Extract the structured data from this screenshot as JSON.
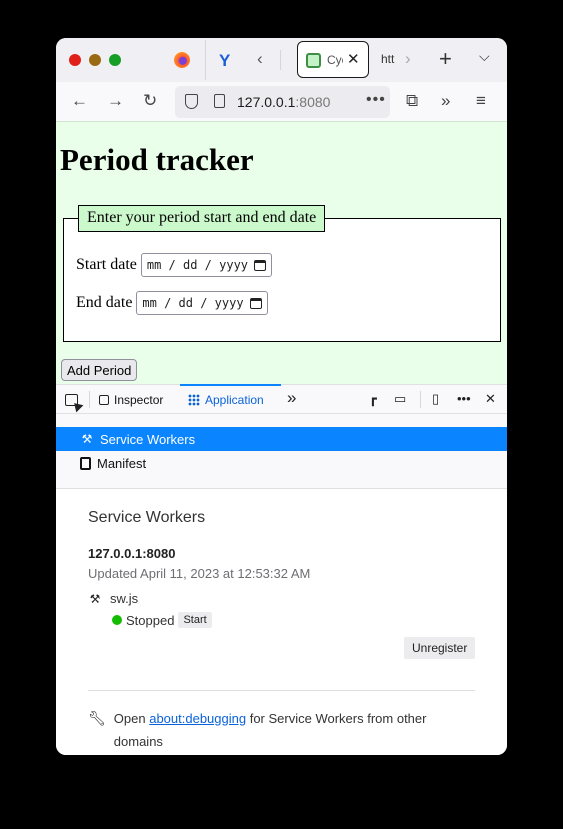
{
  "browser": {
    "tabs": [
      {
        "title": "Cycle Tracker",
        "visible_text": "Cyc",
        "active": true
      },
      {
        "title": "htt",
        "visible_text": "htt",
        "active": false
      }
    ],
    "url_host": "127.0.0.1",
    "url_port": ":8080",
    "icons": {
      "back": "←",
      "forward": "→",
      "reload": "↻",
      "more": "•••",
      "extensions": "⧉",
      "overflow": "»",
      "menu": "≡",
      "tab_scroll_left": "‹",
      "tab_scroll_right": "›",
      "new_tab": "+",
      "tab_list": "⌄",
      "close_tab": "✕"
    }
  },
  "page": {
    "title": "Period tracker",
    "legend": "Enter your period start and end date",
    "start_label": "Start date",
    "end_label": "End date",
    "date_placeholder": "mm / dd / yyyy",
    "add_button": "Add Period",
    "background_color": "#e9ffe9",
    "legend_color": "#ccf9cc"
  },
  "devtools": {
    "toolbar": {
      "tabs": [
        {
          "label": "Inspector",
          "active": false
        },
        {
          "label": "Application",
          "active": true
        }
      ],
      "overflow": "»",
      "more": "•••",
      "close": "✕"
    },
    "sidebar": {
      "items": [
        {
          "label": "Service Workers",
          "selected": true
        },
        {
          "label": "Manifest",
          "selected": false
        }
      ]
    },
    "panel": {
      "title": "Service Workers",
      "host": "127.0.0.1:8080",
      "updated": "Updated April 11, 2023 at 12:53:32 AM",
      "script": "sw.js",
      "status": "Stopped",
      "status_color": "#12bc00",
      "start_button": "Start",
      "unregister_button": "Unregister",
      "footer_prefix": "Open",
      "footer_link": "about:debugging",
      "footer_suffix": "for Service Workers from other domains"
    },
    "accent_color": "#0a84ff"
  }
}
